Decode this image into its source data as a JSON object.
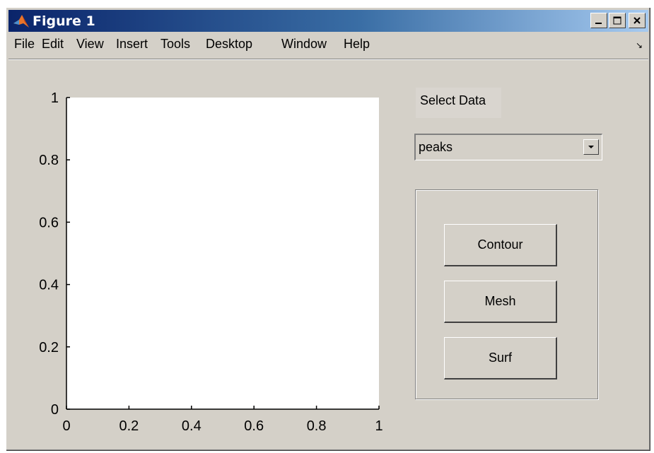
{
  "window": {
    "title": "Figure 1",
    "minimize_label": "_",
    "close_label": "×"
  },
  "menu": {
    "items": [
      {
        "label": "File"
      },
      {
        "label": "Edit"
      },
      {
        "label": "View"
      },
      {
        "label": "Insert"
      },
      {
        "label": "Tools"
      },
      {
        "label": "Desktop"
      },
      {
        "label": "Window"
      },
      {
        "label": "Help"
      }
    ],
    "dock_arrow": "↘"
  },
  "axes": {
    "xlim": [
      0,
      1
    ],
    "ylim": [
      0,
      1
    ],
    "x_ticks": [
      {
        "value": 0,
        "label": "0"
      },
      {
        "value": 0.2,
        "label": "0.2"
      },
      {
        "value": 0.4,
        "label": "0.4"
      },
      {
        "value": 0.6,
        "label": "0.6"
      },
      {
        "value": 0.8,
        "label": "0.8"
      },
      {
        "value": 1,
        "label": "1"
      }
    ],
    "y_ticks": [
      {
        "value": 0,
        "label": "0"
      },
      {
        "value": 0.2,
        "label": "0.2"
      },
      {
        "value": 0.4,
        "label": "0.4"
      },
      {
        "value": 0.6,
        "label": "0.6"
      },
      {
        "value": 0.8,
        "label": "0.8"
      },
      {
        "value": 1,
        "label": "1"
      }
    ]
  },
  "controls": {
    "select_label": "Select Data",
    "popup_value": "peaks",
    "buttons": {
      "contour": "Contour",
      "mesh": "Mesh",
      "surf": "Surf"
    }
  },
  "colors": {
    "title_gradient_start": "#0a246a",
    "title_gradient_end": "#a6caf0",
    "face": "#d4d0c8"
  }
}
